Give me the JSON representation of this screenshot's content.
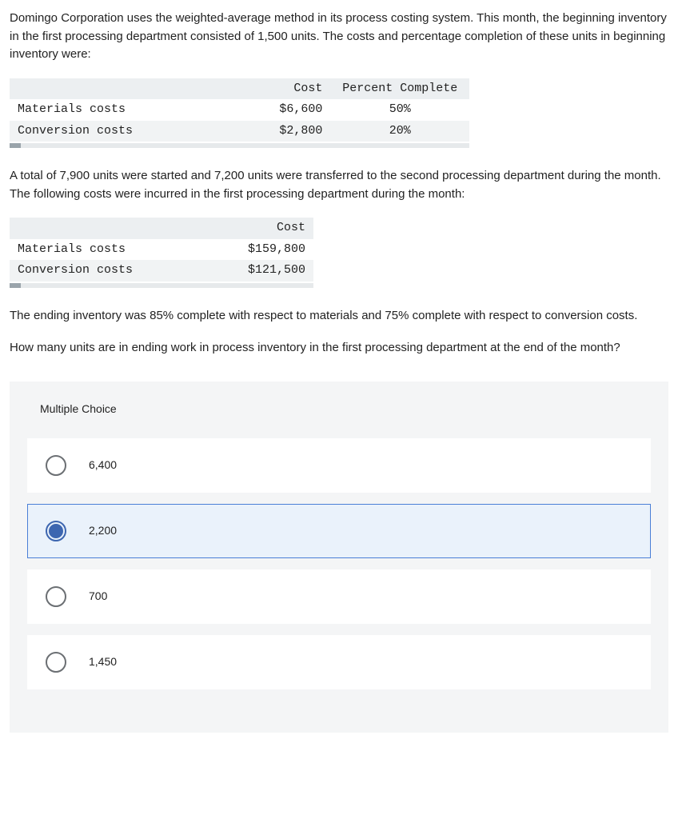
{
  "question": {
    "intro": "Domingo Corporation uses the weighted-average method in its process costing system. This month, the beginning inventory in the first processing department consisted of 1,500 units. The costs and percentage completion of these units in beginning inventory were:",
    "table1": {
      "headers": {
        "c1": "",
        "c2": "Cost",
        "c3": "Percent Complete"
      },
      "rows": [
        {
          "label": "Materials costs",
          "cost": "$6,600",
          "pct": "50%"
        },
        {
          "label": "Conversion costs",
          "cost": "$2,800",
          "pct": "20%"
        }
      ]
    },
    "mid": "A total of 7,900 units were started and 7,200 units were transferred to the second processing department during the month. The following costs were incurred in the first processing department during the month:",
    "table2": {
      "headers": {
        "c1": "",
        "c2": "Cost"
      },
      "rows": [
        {
          "label": "Materials costs",
          "cost": "$159,800"
        },
        {
          "label": "Conversion costs",
          "cost": "$121,500"
        }
      ]
    },
    "ending": "The ending inventory was 85% complete with respect to materials and 75% complete with respect to conversion costs.",
    "prompt": "How many units are in ending work in process inventory in the first processing department at the end of the month?"
  },
  "mc": {
    "title": "Multiple Choice",
    "options": [
      {
        "label": "6,400",
        "selected": false
      },
      {
        "label": "2,200",
        "selected": true
      },
      {
        "label": "700",
        "selected": false
      },
      {
        "label": "1,450",
        "selected": false
      }
    ]
  }
}
